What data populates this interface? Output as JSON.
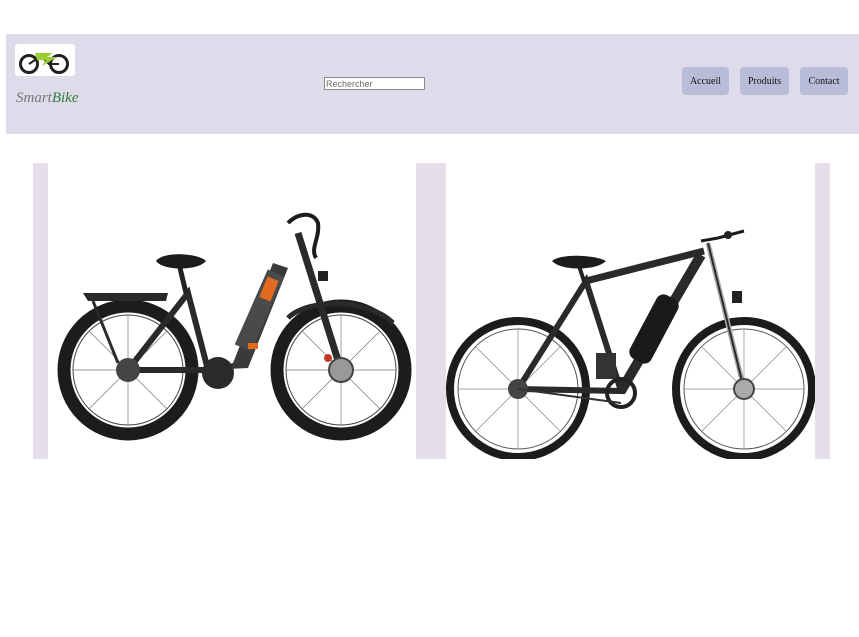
{
  "header": {
    "logo_icon": "e-bike-logo-icon",
    "brand": {
      "part1": "Smart",
      "part2": "Bike",
      "accent_color": "#2f7d3a"
    },
    "search": {
      "placeholder": "Rechercher",
      "value": ""
    },
    "nav": [
      {
        "label": "Accueil"
      },
      {
        "label": "Produits"
      },
      {
        "label": "Contact"
      }
    ],
    "background": "#dfdbea",
    "button_color": "#b9bcd8"
  },
  "products": [
    {
      "image": "fat-tire-ebike-step-through",
      "accent_color": "#e06a1f"
    },
    {
      "image": "mountain-ebike-black",
      "accent_color": "#1a1a1a"
    }
  ],
  "product_area_background": "#e6deeb"
}
